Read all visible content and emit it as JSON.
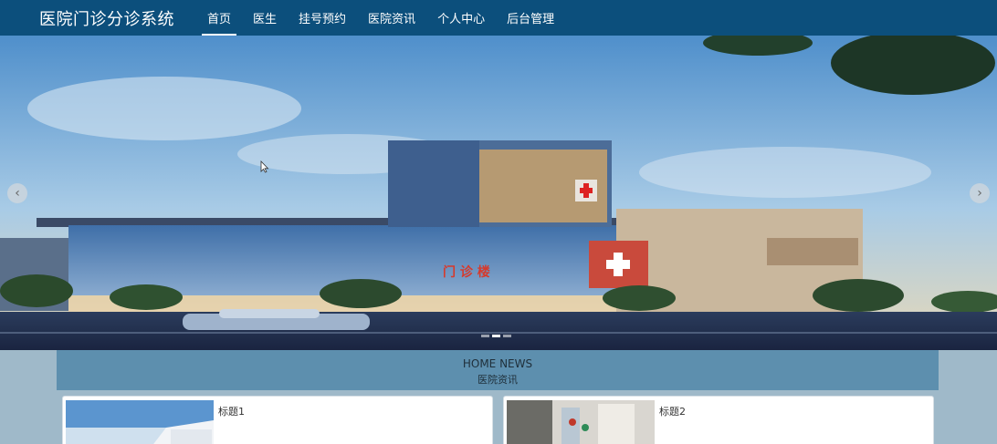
{
  "header": {
    "brand": "医院门诊分诊系统",
    "nav": [
      {
        "label": "首页",
        "active": true
      },
      {
        "label": "医生",
        "active": false
      },
      {
        "label": "挂号预约",
        "active": false
      },
      {
        "label": "医院资讯",
        "active": false
      },
      {
        "label": "个人中心",
        "active": false
      },
      {
        "label": "后台管理",
        "active": false
      }
    ]
  },
  "carousel": {
    "sign_text": "门 诊 楼",
    "slide_count": 3,
    "active_index": 1
  },
  "news": {
    "title_en": "HOME NEWS",
    "title_cn": "医院资讯",
    "items": [
      {
        "title": "标题1"
      },
      {
        "title": "标题2"
      }
    ]
  },
  "colors": {
    "nav_bg": "#0c4f7c",
    "section_bg": "#9fb9c9",
    "news_head_bg": "#5d8fae"
  }
}
